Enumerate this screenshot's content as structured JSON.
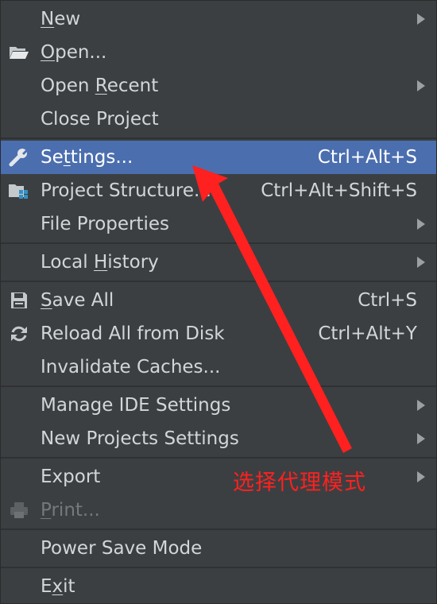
{
  "menu": {
    "items": [
      {
        "id": "new",
        "pre": "",
        "mn": "N",
        "post": "ew",
        "shortcut": "",
        "submenu": true,
        "icon": ""
      },
      {
        "id": "open",
        "pre": "",
        "mn": "O",
        "post": "pen...",
        "shortcut": "",
        "submenu": false,
        "icon": "folder-open-icon"
      },
      {
        "id": "open-recent",
        "pre": "Open ",
        "mn": "R",
        "post": "ecent",
        "shortcut": "",
        "submenu": true,
        "icon": ""
      },
      {
        "id": "close-project",
        "pre": "Close Project",
        "mn": "",
        "post": "",
        "shortcut": "",
        "submenu": false,
        "icon": ""
      },
      {
        "id": "settings",
        "pre": "Se",
        "mn": "t",
        "post": "tings...",
        "shortcut": "Ctrl+Alt+S",
        "submenu": false,
        "icon": "wrench-icon",
        "selected": true
      },
      {
        "id": "project-structure",
        "pre": "Project Structure...",
        "mn": "",
        "post": "",
        "shortcut": "Ctrl+Alt+Shift+S",
        "submenu": false,
        "icon": "project-structure-icon"
      },
      {
        "id": "file-properties",
        "pre": "File Properties",
        "mn": "",
        "post": "",
        "shortcut": "",
        "submenu": true,
        "icon": ""
      },
      {
        "id": "local-history",
        "pre": "Local ",
        "mn": "H",
        "post": "istory",
        "shortcut": "",
        "submenu": true,
        "icon": ""
      },
      {
        "id": "save-all",
        "pre": "",
        "mn": "S",
        "post": "ave All",
        "shortcut": "Ctrl+S",
        "submenu": false,
        "icon": "save-icon"
      },
      {
        "id": "reload-all",
        "pre": "Reload All from Disk",
        "mn": "",
        "post": "",
        "shortcut": "Ctrl+Alt+Y",
        "submenu": false,
        "icon": "reload-icon"
      },
      {
        "id": "invalidate-caches",
        "pre": "Invalidate Caches...",
        "mn": "",
        "post": "",
        "shortcut": "",
        "submenu": false,
        "icon": ""
      },
      {
        "id": "manage-ide-settings",
        "pre": "Manage IDE Settings",
        "mn": "",
        "post": "",
        "shortcut": "",
        "submenu": true,
        "icon": ""
      },
      {
        "id": "new-projects-settings",
        "pre": "New Projects Settings",
        "mn": "",
        "post": "",
        "shortcut": "",
        "submenu": true,
        "icon": ""
      },
      {
        "id": "export",
        "pre": "Export",
        "mn": "",
        "post": "",
        "shortcut": "",
        "submenu": true,
        "icon": ""
      },
      {
        "id": "print",
        "pre": "",
        "mn": "P",
        "post": "rint...",
        "shortcut": "",
        "submenu": false,
        "icon": "print-icon",
        "disabled": true
      },
      {
        "id": "power-save-mode",
        "pre": "Power Save Mode",
        "mn": "",
        "post": "",
        "shortcut": "",
        "submenu": false,
        "icon": ""
      },
      {
        "id": "exit",
        "pre": "E",
        "mn": "x",
        "post": "it",
        "shortcut": "",
        "submenu": false,
        "icon": ""
      }
    ]
  },
  "annotation": {
    "text": "选择代理模式",
    "color": "#ff2020"
  },
  "colors": {
    "menu_background": "#3c3f41",
    "selected_background": "#4b6eaf",
    "text": "#d3d6d9",
    "disabled_text": "#76797c"
  }
}
